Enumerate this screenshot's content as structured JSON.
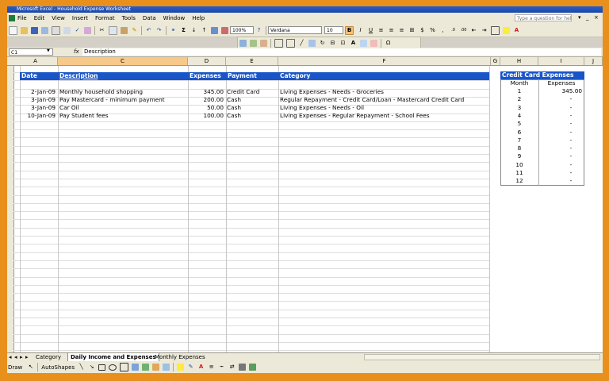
{
  "window": {
    "title": "Microsoft Excel - Household Expense Worksheet"
  },
  "menu": {
    "items": [
      "File",
      "Edit",
      "View",
      "Insert",
      "Format",
      "Tools",
      "Data",
      "Window",
      "Help"
    ],
    "help_placeholder": "Type a question for help"
  },
  "toolbar": {
    "zoom": "100%",
    "font": "Verdana",
    "font_size": "10",
    "currency": "$",
    "percent": "%"
  },
  "formula_bar": {
    "name_box": "C1",
    "fx": "fx",
    "content": "Description"
  },
  "columns": [
    "A",
    "C",
    "D",
    "E",
    "F",
    "G",
    "H",
    "I",
    "J"
  ],
  "table": {
    "headers": {
      "date": "Date",
      "description": "Description",
      "expenses": "Expenses",
      "payment": "Payment",
      "category": "Category"
    },
    "rows": [
      {
        "date": "2-Jan-09",
        "description": "Monthly household shopping",
        "expenses": "345.00",
        "payment": "Credit Card",
        "category": "Living Expenses - Needs - Groceries"
      },
      {
        "date": "3-Jan-09",
        "description": "Pay Mastercard - minimum payment",
        "expenses": "200.00",
        "payment": "Cash",
        "category": "Regular Repayment - Credit Card/Loan - Mastercard Credit Card"
      },
      {
        "date": "3-Jan-09",
        "description": "Car Oil",
        "expenses": "50.00",
        "payment": "Cash",
        "category": "Living Expenses - Needs - Oil"
      },
      {
        "date": "10-Jan-09",
        "description": "Pay Student fees",
        "expenses": "100.00",
        "payment": "Cash",
        "category": "Living Expenses - Regular Repayment - School Fees"
      }
    ]
  },
  "credit_card_table": {
    "title": "Credit Card Expenses",
    "col_month": "Month",
    "col_expenses": "Expenses",
    "rows": [
      {
        "month": "1",
        "expenses": "345.00"
      },
      {
        "month": "2",
        "expenses": "-"
      },
      {
        "month": "3",
        "expenses": "-"
      },
      {
        "month": "4",
        "expenses": "-"
      },
      {
        "month": "5",
        "expenses": "-"
      },
      {
        "month": "6",
        "expenses": "-"
      },
      {
        "month": "7",
        "expenses": "-"
      },
      {
        "month": "8",
        "expenses": "-"
      },
      {
        "month": "9",
        "expenses": "-"
      },
      {
        "month": "10",
        "expenses": "-"
      },
      {
        "month": "11",
        "expenses": "-"
      },
      {
        "month": "12",
        "expenses": "-"
      }
    ]
  },
  "sheet_tabs": [
    "Category",
    "Daily Income and Expenses",
    "Monthly Expenses"
  ],
  "active_tab": "Daily Income and Expenses",
  "drawing_toolbar": {
    "draw_label": "Draw",
    "autoshapes_label": "AutoShapes"
  },
  "colors": {
    "header_blue": "#1a55c8",
    "frame_orange": "#e98f1c",
    "toolbar_bg": "#ece9d8"
  }
}
